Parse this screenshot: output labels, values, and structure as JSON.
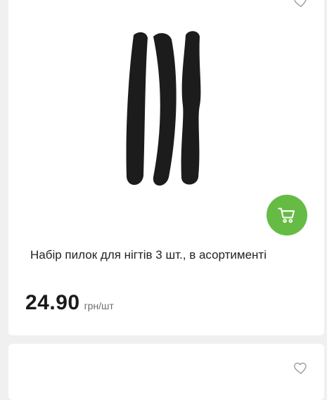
{
  "product": {
    "name": "Набір пилок для нігтів 3 шт., в асортименті",
    "price": "24.90",
    "price_unit": "грн/шт",
    "image_icon": "nail-files-image",
    "favorite_icon": "heart-icon",
    "cart_icon": "cart-icon"
  },
  "next_product": {
    "favorite_icon": "heart-icon"
  },
  "colors": {
    "accent": "#66bb44",
    "card_bg": "#ffffff",
    "page_bg": "#f0f0f0",
    "heart": "#9a9a9a"
  }
}
